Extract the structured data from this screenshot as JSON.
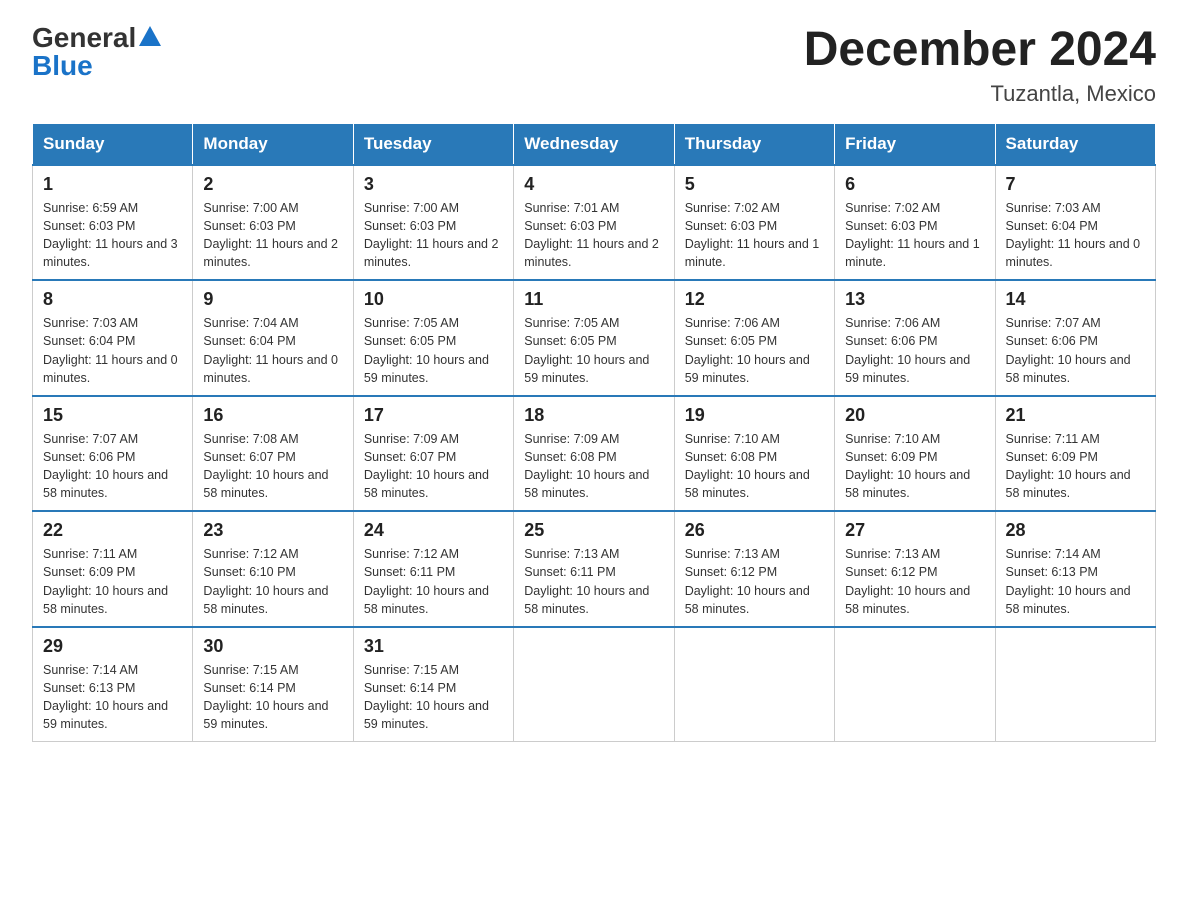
{
  "logo": {
    "general": "General",
    "blue": "Blue"
  },
  "title": "December 2024",
  "location": "Tuzantla, Mexico",
  "weekdays": [
    "Sunday",
    "Monday",
    "Tuesday",
    "Wednesday",
    "Thursday",
    "Friday",
    "Saturday"
  ],
  "weeks": [
    [
      {
        "day": "1",
        "sunrise": "6:59 AM",
        "sunset": "6:03 PM",
        "daylight": "11 hours and 3 minutes."
      },
      {
        "day": "2",
        "sunrise": "7:00 AM",
        "sunset": "6:03 PM",
        "daylight": "11 hours and 2 minutes."
      },
      {
        "day": "3",
        "sunrise": "7:00 AM",
        "sunset": "6:03 PM",
        "daylight": "11 hours and 2 minutes."
      },
      {
        "day": "4",
        "sunrise": "7:01 AM",
        "sunset": "6:03 PM",
        "daylight": "11 hours and 2 minutes."
      },
      {
        "day": "5",
        "sunrise": "7:02 AM",
        "sunset": "6:03 PM",
        "daylight": "11 hours and 1 minute."
      },
      {
        "day": "6",
        "sunrise": "7:02 AM",
        "sunset": "6:03 PM",
        "daylight": "11 hours and 1 minute."
      },
      {
        "day": "7",
        "sunrise": "7:03 AM",
        "sunset": "6:04 PM",
        "daylight": "11 hours and 0 minutes."
      }
    ],
    [
      {
        "day": "8",
        "sunrise": "7:03 AM",
        "sunset": "6:04 PM",
        "daylight": "11 hours and 0 minutes."
      },
      {
        "day": "9",
        "sunrise": "7:04 AM",
        "sunset": "6:04 PM",
        "daylight": "11 hours and 0 minutes."
      },
      {
        "day": "10",
        "sunrise": "7:05 AM",
        "sunset": "6:05 PM",
        "daylight": "10 hours and 59 minutes."
      },
      {
        "day": "11",
        "sunrise": "7:05 AM",
        "sunset": "6:05 PM",
        "daylight": "10 hours and 59 minutes."
      },
      {
        "day": "12",
        "sunrise": "7:06 AM",
        "sunset": "6:05 PM",
        "daylight": "10 hours and 59 minutes."
      },
      {
        "day": "13",
        "sunrise": "7:06 AM",
        "sunset": "6:06 PM",
        "daylight": "10 hours and 59 minutes."
      },
      {
        "day": "14",
        "sunrise": "7:07 AM",
        "sunset": "6:06 PM",
        "daylight": "10 hours and 58 minutes."
      }
    ],
    [
      {
        "day": "15",
        "sunrise": "7:07 AM",
        "sunset": "6:06 PM",
        "daylight": "10 hours and 58 minutes."
      },
      {
        "day": "16",
        "sunrise": "7:08 AM",
        "sunset": "6:07 PM",
        "daylight": "10 hours and 58 minutes."
      },
      {
        "day": "17",
        "sunrise": "7:09 AM",
        "sunset": "6:07 PM",
        "daylight": "10 hours and 58 minutes."
      },
      {
        "day": "18",
        "sunrise": "7:09 AM",
        "sunset": "6:08 PM",
        "daylight": "10 hours and 58 minutes."
      },
      {
        "day": "19",
        "sunrise": "7:10 AM",
        "sunset": "6:08 PM",
        "daylight": "10 hours and 58 minutes."
      },
      {
        "day": "20",
        "sunrise": "7:10 AM",
        "sunset": "6:09 PM",
        "daylight": "10 hours and 58 minutes."
      },
      {
        "day": "21",
        "sunrise": "7:11 AM",
        "sunset": "6:09 PM",
        "daylight": "10 hours and 58 minutes."
      }
    ],
    [
      {
        "day": "22",
        "sunrise": "7:11 AM",
        "sunset": "6:09 PM",
        "daylight": "10 hours and 58 minutes."
      },
      {
        "day": "23",
        "sunrise": "7:12 AM",
        "sunset": "6:10 PM",
        "daylight": "10 hours and 58 minutes."
      },
      {
        "day": "24",
        "sunrise": "7:12 AM",
        "sunset": "6:11 PM",
        "daylight": "10 hours and 58 minutes."
      },
      {
        "day": "25",
        "sunrise": "7:13 AM",
        "sunset": "6:11 PM",
        "daylight": "10 hours and 58 minutes."
      },
      {
        "day": "26",
        "sunrise": "7:13 AM",
        "sunset": "6:12 PM",
        "daylight": "10 hours and 58 minutes."
      },
      {
        "day": "27",
        "sunrise": "7:13 AM",
        "sunset": "6:12 PM",
        "daylight": "10 hours and 58 minutes."
      },
      {
        "day": "28",
        "sunrise": "7:14 AM",
        "sunset": "6:13 PM",
        "daylight": "10 hours and 58 minutes."
      }
    ],
    [
      {
        "day": "29",
        "sunrise": "7:14 AM",
        "sunset": "6:13 PM",
        "daylight": "10 hours and 59 minutes."
      },
      {
        "day": "30",
        "sunrise": "7:15 AM",
        "sunset": "6:14 PM",
        "daylight": "10 hours and 59 minutes."
      },
      {
        "day": "31",
        "sunrise": "7:15 AM",
        "sunset": "6:14 PM",
        "daylight": "10 hours and 59 minutes."
      },
      null,
      null,
      null,
      null
    ]
  ],
  "labels": {
    "sunrise": "Sunrise:",
    "sunset": "Sunset:",
    "daylight": "Daylight:"
  }
}
